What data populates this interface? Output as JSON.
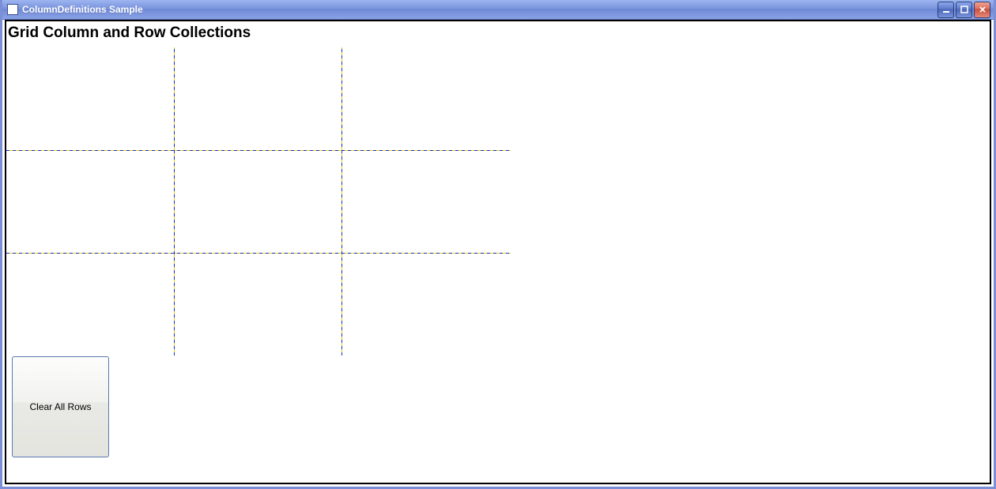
{
  "window": {
    "title": "ColumnDefinitions Sample"
  },
  "content": {
    "heading": "Grid Column and Row Collections"
  },
  "buttons": {
    "clear_rows": "Clear All Rows"
  }
}
